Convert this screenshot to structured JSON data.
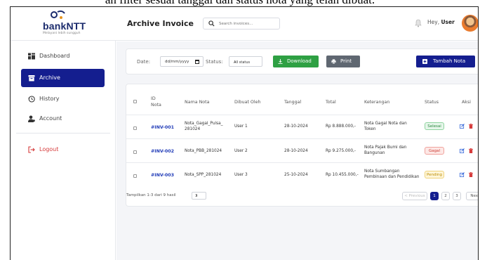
{
  "caption": "an filter sesuai tanggal dan status nota yang telah dibuat.",
  "brand": {
    "name": "bankNTT",
    "tagline": "Melayani lebih sungguh"
  },
  "header": {
    "title": "Archive Invoice",
    "search_placeholder": "Search invoices...",
    "greeting": "Hey,",
    "user": "User"
  },
  "sidebar": {
    "items": [
      {
        "label": "Dashboard",
        "icon": "dashboard-icon"
      },
      {
        "label": "Archive",
        "icon": "archive-icon"
      },
      {
        "label": "History",
        "icon": "history-icon"
      },
      {
        "label": "Account",
        "icon": "account-icon"
      }
    ],
    "logout": "Logout"
  },
  "filter": {
    "date_label": "Date:",
    "date_value": "dd/mm/yyyy",
    "status_label": "Status:",
    "status_value": "All status",
    "download": "Download",
    "print": "Print",
    "add": "Tambah Nota"
  },
  "table": {
    "headers": {
      "id_line1": "ID",
      "id_line2": "Nota",
      "nama": "Nama Nota",
      "dibuat": "Dibuat Oleh",
      "tanggal": "Tanggal",
      "total": "Total",
      "keterangan": "Keterangan",
      "status": "Status",
      "aksi": "Aksi"
    },
    "rows": [
      {
        "id": "#INV-001",
        "nama1": "Nota_Gagal_Pulsa_",
        "nama2": "281024",
        "dibuat": "User 1",
        "tanggal": "28-10-2024",
        "total": "Rp 8.888.000,-",
        "ket1": "Nota Gagal Nota dan",
        "ket2": "Token",
        "status": "Selesai"
      },
      {
        "id": "#INV-002",
        "nama1": "Nota_PBB_281024",
        "nama2": "",
        "dibuat": "User 2",
        "tanggal": "28-10-2024",
        "total": "Rp 9.275.000,-",
        "ket1": "Nota Pajak Bumi dan",
        "ket2": "Bangunan",
        "status": "Gagal"
      },
      {
        "id": "#INV-003",
        "nama1": "Nota_SPP_281024",
        "nama2": "",
        "dibuat": "User 3",
        "tanggal": "25-10-2024",
        "total": "Rp 10.455.000,-",
        "ket1": "Nota Sumbangan",
        "ket2": "Pembinaan dan Pendidikan",
        "status": "Pending"
      }
    ]
  },
  "pagination": {
    "info": "Tampilkan 1-3 dari 9 hasil",
    "per_page": "3",
    "prev": "< Previous",
    "pages": [
      "1",
      "2",
      "3"
    ],
    "next": "Next >"
  },
  "colors": {
    "primary": "#141e8f",
    "download": "#2ea043",
    "print": "#5f6771",
    "logout": "#d63b3b"
  }
}
